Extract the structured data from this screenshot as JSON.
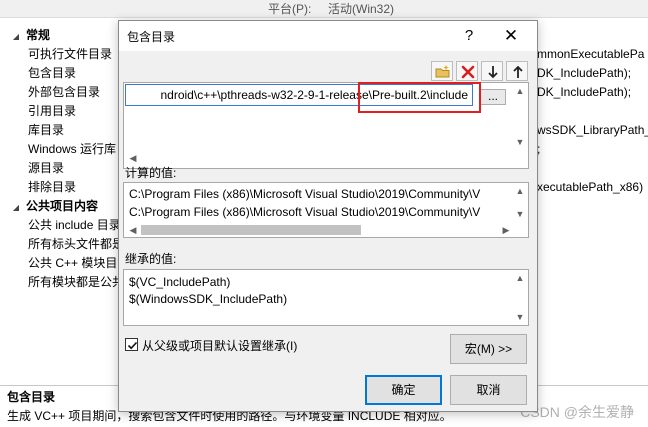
{
  "background": {
    "top_fragments": [
      "平台(P):",
      "活动(Win32)"
    ],
    "tree": [
      {
        "type": "category",
        "label": "常规"
      },
      {
        "type": "item",
        "label": "可执行文件目录"
      },
      {
        "type": "item",
        "label": "包含目录"
      },
      {
        "type": "item",
        "label": "外部包含目录"
      },
      {
        "type": "item",
        "label": "引用目录"
      },
      {
        "type": "item",
        "label": "库目录"
      },
      {
        "type": "item",
        "label": "Windows 运行库"
      },
      {
        "type": "item",
        "label": "源目录"
      },
      {
        "type": "item",
        "label": "排除目录"
      },
      {
        "type": "category",
        "label": "公共项目内容"
      },
      {
        "type": "item",
        "label": "公共 include 目录"
      },
      {
        "type": "item",
        "label": "所有标头文件都是"
      },
      {
        "type": "item",
        "label": "公共 C++ 模块目"
      },
      {
        "type": "item",
        "label": "所有模块都是公共"
      }
    ],
    "values": [
      "mmonExecutablePa",
      "DK_IncludePath);",
      "DK_IncludePath);",
      "",
      "wsSDK_LibraryPath_",
      ";",
      "",
      "xecutablePath_x86)"
    ],
    "description_title": "包含目录",
    "description_text": "生成 VC++ 项目期间，搜索包含文件时使用的路径。与环境变量 INCLUDE 相对应。",
    "watermark": "CSDN @余生爱静"
  },
  "dialog": {
    "title": "包含目录",
    "help_glyph": "?",
    "close_glyph": "✕",
    "toolbar": {
      "icons": [
        "new-folder-icon",
        "delete-icon",
        "move-down-icon",
        "move-up-icon"
      ]
    },
    "edit_value": "ndroid\\c++\\pthreads-w32-2-9-1-release\\Pre-built.2\\include",
    "ellipsis_label": "...",
    "computed_label": "计算的值:",
    "computed_values": [
      "C:\\Program Files (x86)\\Microsoft Visual Studio\\2019\\Community\\V",
      "C:\\Program Files (x86)\\Microsoft Visual Studio\\2019\\Community\\V"
    ],
    "inherited_label": "继承的值:",
    "inherited_values": [
      "$(VC_IncludePath)",
      "$(WindowsSDK_IncludePath)"
    ],
    "inherit_checkbox": {
      "label": "从父级或项目默认设置继承(I)",
      "checked": true
    },
    "macro_button": "宏(M) >>",
    "ok_button": "确定",
    "cancel_button": "取消"
  },
  "colors": {
    "dialog_bg": "#f0f0f0",
    "accent_blue": "#0078d7",
    "highlight_red": "#e02020"
  }
}
